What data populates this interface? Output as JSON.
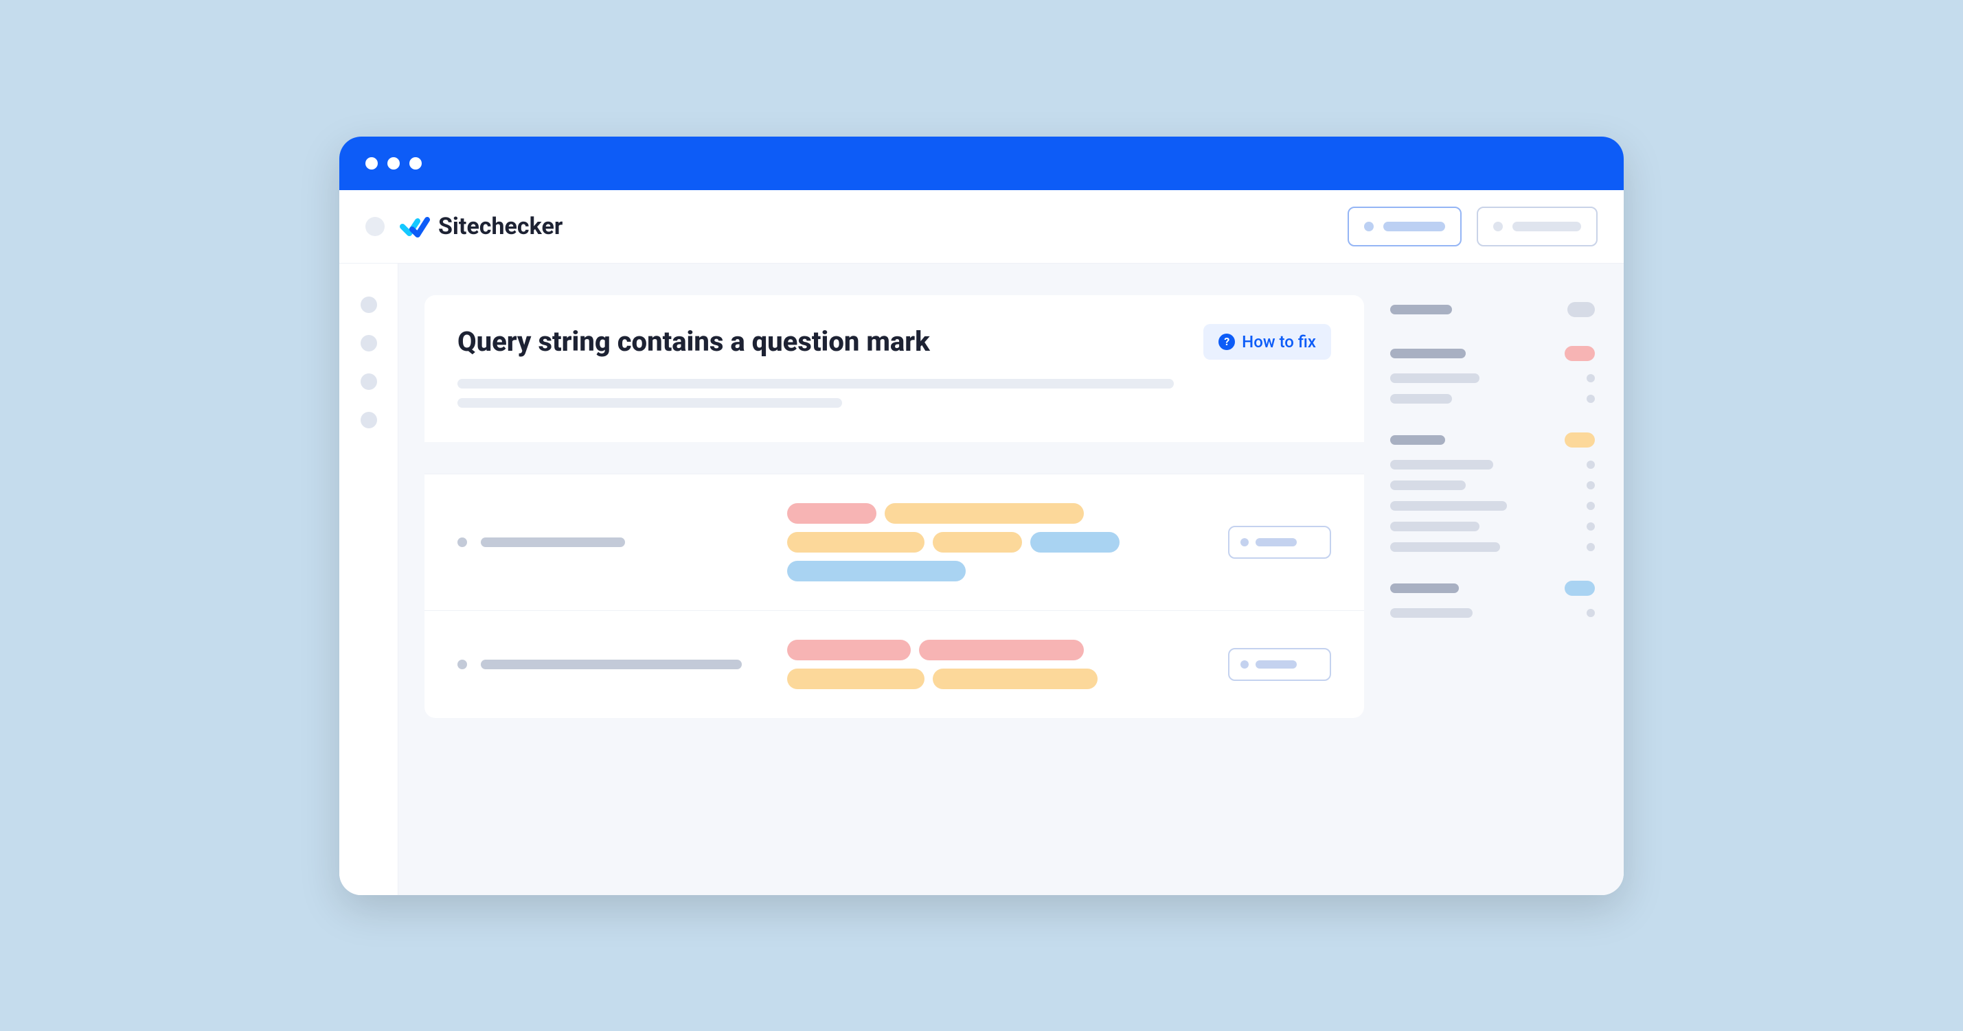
{
  "brand": {
    "name": "Sitechecker"
  },
  "page": {
    "title": "Query string contains a question mark",
    "how_to_fix_label": "How to fix"
  }
}
